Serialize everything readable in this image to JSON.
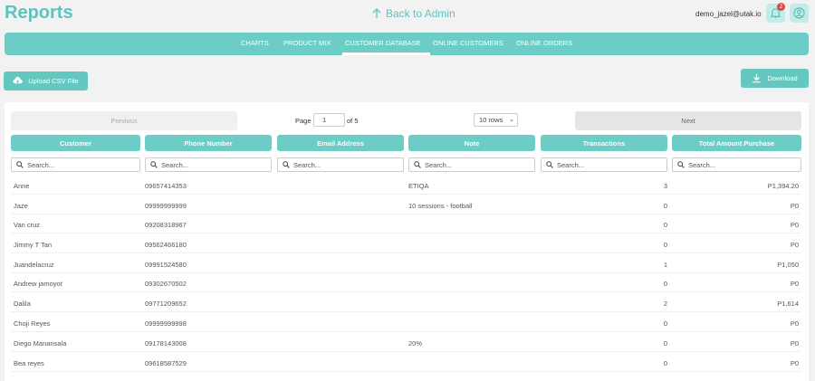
{
  "header": {
    "title": "Reports",
    "back_label": "Back to Admin",
    "user_email": "demo_jazel@utak.io",
    "notification_count": "2"
  },
  "nav": {
    "items": [
      "CHARTS",
      "PRODUCT MIX",
      "CUSTOMER DATABASE",
      "ONLINE CUSTOMERS",
      "ONLINE ORDERS"
    ],
    "active": "CUSTOMER DATABASE"
  },
  "actions": {
    "upload_label": "Upload CSV File",
    "download_label": "Download"
  },
  "pagination": {
    "previous_label": "Previous",
    "next_label": "Next",
    "page_label": "Page",
    "page_value": "1",
    "of_label": "of 5",
    "rows_label": "10 rows"
  },
  "table": {
    "columns": [
      "Customer",
      "Phone Number",
      "Email Address",
      "Note",
      "Transactions",
      "Total Amount Purchase"
    ],
    "search_placeholder": "Search...",
    "rows": [
      {
        "customer": "Anne",
        "phone": "09657414353",
        "email": "",
        "note": "ETIQA",
        "transactions": "3",
        "total": "P1,394.20"
      },
      {
        "customer": "Jaze",
        "phone": "09999999999",
        "email": "",
        "note": "10 sessions - football",
        "transactions": "0",
        "total": "P0"
      },
      {
        "customer": "Van cruz",
        "phone": "09208318967",
        "email": "",
        "note": "",
        "transactions": "0",
        "total": "P0"
      },
      {
        "customer": "Jimmy T Tan",
        "phone": "09562466180",
        "email": "",
        "note": "",
        "transactions": "0",
        "total": "P0"
      },
      {
        "customer": "Juandelacruz",
        "phone": "09991524580",
        "email": "",
        "note": "",
        "transactions": "1",
        "total": "P1,050"
      },
      {
        "customer": "Andrew jamoyot",
        "phone": "09302670502",
        "email": "",
        "note": "",
        "transactions": "0",
        "total": "P0"
      },
      {
        "customer": "Dalila",
        "phone": "09771209652",
        "email": "",
        "note": "",
        "transactions": "2",
        "total": "P1,614"
      },
      {
        "customer": "Choji Reyes",
        "phone": "09999999998",
        "email": "",
        "note": "",
        "transactions": "0",
        "total": "P0"
      },
      {
        "customer": "Diego Manansala",
        "phone": "09178143008",
        "email": "",
        "note": "20%",
        "transactions": "0",
        "total": "P0"
      },
      {
        "customer": "Bea reyes",
        "phone": "09618587529",
        "email": "",
        "note": "",
        "transactions": "0",
        "total": "P0"
      }
    ]
  },
  "colors": {
    "accent": "#6ccdc6",
    "title": "#5cc4be",
    "badge": "#e04848"
  },
  "icons": {
    "back": "arrow-up-icon",
    "bell": "bell-icon",
    "user": "user-circle-icon",
    "upload": "cloud-upload-icon",
    "download": "download-icon",
    "search": "search-icon"
  }
}
